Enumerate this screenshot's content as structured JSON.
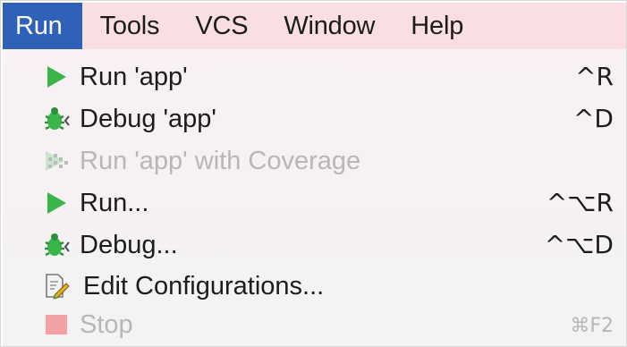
{
  "menubar": {
    "items": [
      {
        "label": "Run",
        "active": true
      },
      {
        "label": "Tools"
      },
      {
        "label": "VCS"
      },
      {
        "label": "Window"
      },
      {
        "label": "Help"
      }
    ]
  },
  "run_menu": {
    "items": [
      {
        "label": "Run 'app'",
        "shortcut": "^R",
        "icon": "run-icon",
        "enabled": true
      },
      {
        "label": "Debug 'app'",
        "shortcut": "^D",
        "icon": "debug-icon",
        "enabled": true
      },
      {
        "label": "Run 'app' with Coverage",
        "shortcut": "",
        "icon": "coverage-icon",
        "enabled": false
      },
      {
        "label": "Run...",
        "shortcut": "^⌥R",
        "icon": "run-icon",
        "enabled": true
      },
      {
        "label": "Debug...",
        "shortcut": "^⌥D",
        "icon": "debug-icon",
        "enabled": true
      },
      {
        "label": "Edit Configurations...",
        "shortcut": "",
        "icon": "edit-configurations-icon",
        "enabled": true
      },
      {
        "label": "Stop",
        "shortcut": "⌘F2",
        "icon": "stop-icon",
        "enabled": false
      }
    ]
  },
  "colors": {
    "menubar_bg": "#f9dfe3",
    "active_menu_bg": "#2f61b8",
    "run_green": "#3ab54a",
    "stop_red": "#f2a2a2"
  }
}
